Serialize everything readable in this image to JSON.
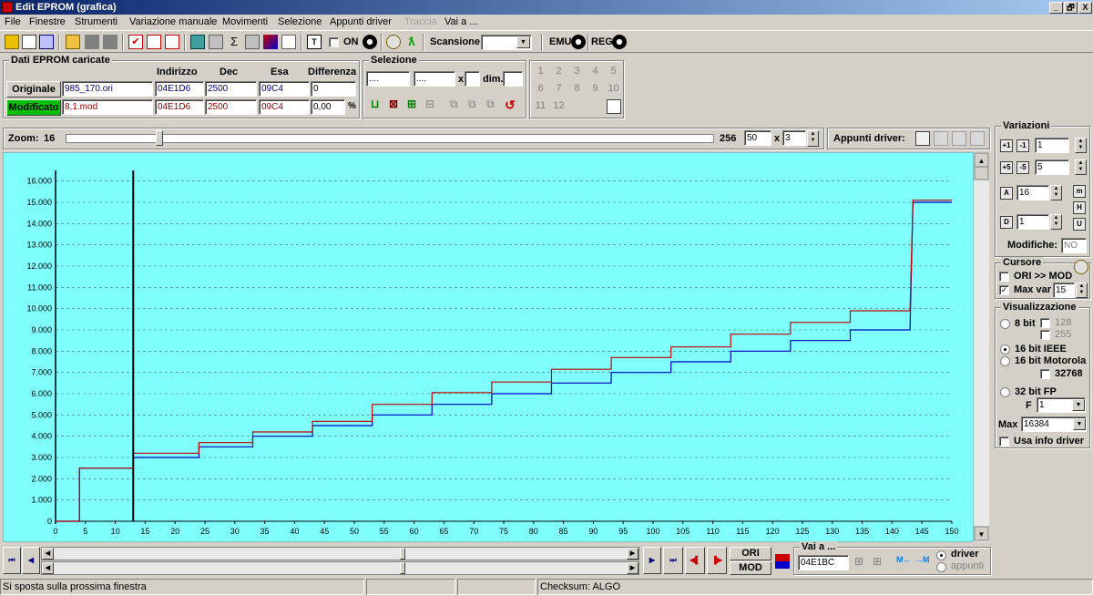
{
  "window": {
    "title": "Edit EPROM (grafica)",
    "min": "_",
    "max": "🗗",
    "close": "X"
  },
  "menu": [
    "File",
    "Finestre",
    "Strumenti",
    "Variazione manuale",
    "Movimenti",
    "Selezione",
    "Appunti driver",
    "Traccia",
    "Vai a ..."
  ],
  "menu_disabled": "Traccia",
  "toolbar": {
    "on_label": "ON",
    "scan_label": "Scansione",
    "emu_label": "EMU",
    "reg_label": "REG"
  },
  "dati": {
    "title": "Dati EPROM caricate",
    "h_indirizzo": "Indirizzo",
    "h_dec": "Dec",
    "h_esa": "Esa",
    "h_diff": "Differenza",
    "orig_btn": "Originale",
    "mod_btn": "Modificato",
    "orig_file": "985_170.ori",
    "orig_addr": "04E1D6",
    "orig_dec": "2500",
    "orig_esa": "09C4",
    "orig_diff": "0",
    "mod_file": "8,1.mod",
    "mod_addr": "04E1D6",
    "mod_dec": "2500",
    "mod_esa": "09C4",
    "mod_diff": "0,00",
    "pct": "%"
  },
  "selezione": {
    "title": "Selezione",
    "from": "....",
    "to": "....",
    "x": "x",
    "dim": "dim."
  },
  "numbers": [
    "1",
    "2",
    "3",
    "4",
    "5",
    "6",
    "7",
    "8",
    "9",
    "10",
    "11",
    "12"
  ],
  "zoom": {
    "label": "Zoom:",
    "min": "16",
    "max": "256",
    "val": "50",
    "x": "x",
    "mult": "3",
    "appunti": "Appunti driver:"
  },
  "variazioni": {
    "title": "Variazioni",
    "v1": "1",
    "v2": "5",
    "v3": "16",
    "v4": "1",
    "modifiche_label": "Modifiche:",
    "modifiche": "NO"
  },
  "cursore": {
    "title": "Cursore",
    "ori_mod": "ORI >> MOD",
    "maxvar_label": "Max var",
    "maxvar": "15"
  },
  "visual": {
    "title": "Visualizzazione",
    "b8": "8 bit",
    "c128": "128",
    "c255": "255",
    "ieee": "16 bit IEEE",
    "moto": "16 bit Motorola",
    "c32768": "32768",
    "fp": "32 bit FP",
    "f_label": "F",
    "f_val": "1",
    "max_label": "Max",
    "max_val": "16384",
    "usa": "Usa info driver"
  },
  "bottom": {
    "ori": "ORI",
    "mod": "MOD",
    "vai_title": "Vai a ...",
    "vai_val": "04E1BC",
    "driver": "driver",
    "appunti": "appunti"
  },
  "status": {
    "msg": "Si sposta sulla prossima finestra",
    "checksum": "Checksum: ALGO"
  },
  "colors": {
    "plot_bg": "#80ffff",
    "ori_line": "#0000c0",
    "mod_line": "#c00000"
  },
  "chart_data": {
    "type": "line",
    "xlim": [
      0,
      150
    ],
    "ylim": [
      0,
      16500
    ],
    "x_ticks": [
      0,
      5,
      10,
      15,
      20,
      25,
      30,
      35,
      40,
      45,
      50,
      55,
      60,
      65,
      70,
      75,
      80,
      85,
      90,
      95,
      100,
      105,
      110,
      115,
      120,
      125,
      130,
      135,
      140,
      145,
      150
    ],
    "y_ticks": [
      0,
      1000,
      2000,
      3000,
      4000,
      5000,
      6000,
      7000,
      8000,
      9000,
      10000,
      11000,
      12000,
      13000,
      14000,
      15000,
      16000
    ],
    "y_tick_labels": [
      "0",
      "1.000",
      "2.000",
      "3.000",
      "4.000",
      "5.000",
      "6.000",
      "7.000",
      "8.000",
      "9.000",
      "10.000",
      "11.000",
      "12.000",
      "13.000",
      "14.000",
      "15.000",
      "16.000"
    ],
    "cursor_x": 13,
    "series": [
      {
        "key": "ori",
        "points": [
          [
            0,
            0
          ],
          [
            4,
            0
          ],
          [
            4,
            2500
          ],
          [
            13,
            2500
          ],
          [
            13,
            3000
          ],
          [
            24,
            3000
          ],
          [
            24,
            3500
          ],
          [
            33,
            3500
          ],
          [
            33,
            4000
          ],
          [
            43,
            4000
          ],
          [
            43,
            4500
          ],
          [
            53,
            4500
          ],
          [
            53,
            5000
          ],
          [
            63,
            5000
          ],
          [
            63,
            5500
          ],
          [
            73,
            5500
          ],
          [
            73,
            6000
          ],
          [
            83,
            6000
          ],
          [
            83,
            6500
          ],
          [
            93,
            6500
          ],
          [
            93,
            7000
          ],
          [
            103,
            7000
          ],
          [
            103,
            7500
          ],
          [
            113,
            7500
          ],
          [
            113,
            8000
          ],
          [
            123,
            8000
          ],
          [
            123,
            8500
          ],
          [
            133,
            8500
          ],
          [
            133,
            9000
          ],
          [
            143,
            9000
          ],
          [
            143.5,
            15000
          ],
          [
            150,
            15000
          ]
        ]
      },
      {
        "key": "mod",
        "points": [
          [
            0,
            0
          ],
          [
            4,
            0
          ],
          [
            4,
            2500
          ],
          [
            13,
            2500
          ],
          [
            13,
            3200
          ],
          [
            24,
            3200
          ],
          [
            24,
            3700
          ],
          [
            33,
            3700
          ],
          [
            33,
            4200
          ],
          [
            43,
            4200
          ],
          [
            43,
            4700
          ],
          [
            53,
            4700
          ],
          [
            53,
            5500
          ],
          [
            63,
            5500
          ],
          [
            63,
            6050
          ],
          [
            73,
            6050
          ],
          [
            73,
            6550
          ],
          [
            83,
            6550
          ],
          [
            83,
            7150
          ],
          [
            93,
            7150
          ],
          [
            93,
            7700
          ],
          [
            103,
            7700
          ],
          [
            103,
            8200
          ],
          [
            113,
            8200
          ],
          [
            113,
            8800
          ],
          [
            123,
            8800
          ],
          [
            123,
            9350
          ],
          [
            133,
            9350
          ],
          [
            133,
            9900
          ],
          [
            143,
            9900
          ],
          [
            143.5,
            15100
          ],
          [
            150,
            15100
          ]
        ]
      }
    ]
  }
}
